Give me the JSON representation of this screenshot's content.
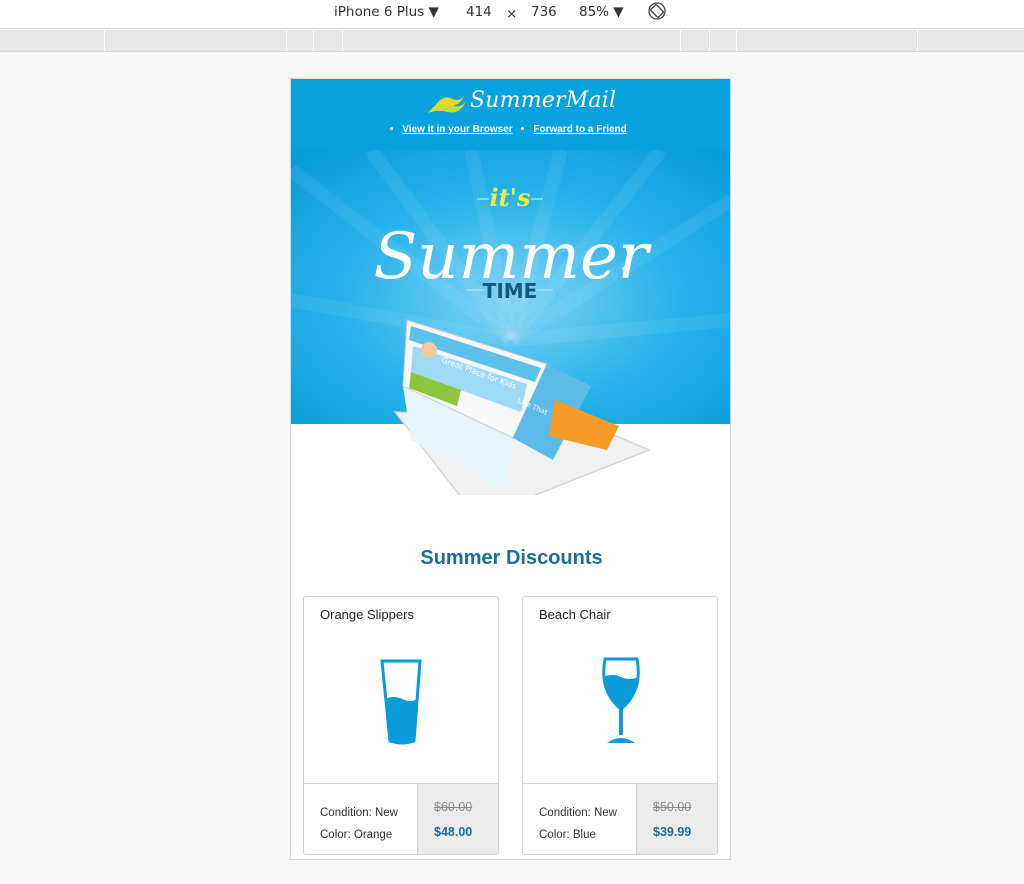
{
  "devtools": {
    "device": "iPhone 6 Plus ▼",
    "width": "414",
    "times": "×",
    "height": "736",
    "zoom": "85% ▼",
    "rotate_icon": "rotate-icon"
  },
  "email": {
    "brand": "SummerMail",
    "links": [
      "View it in your Browser",
      "Forward to a Friend"
    ],
    "hero": {
      "small": "it's",
      "big": "Summer",
      "sub": "TIME",
      "tablet_text": "Great Place for Kids",
      "tablet_side": "Like That"
    },
    "section_title": "Summer Discounts",
    "products": [
      {
        "name": "Orange Slippers",
        "condition": "Condition: New",
        "color": "Color: Orange",
        "old_price": "$60.00",
        "new_price": "$48.00",
        "icon": "tall-glass-icon"
      },
      {
        "name": "Beach Chair",
        "condition": "Condition: New",
        "color": "Color: Blue",
        "old_price": "$50.00",
        "new_price": "$39.99",
        "icon": "wine-glass-icon"
      }
    ]
  },
  "colors": {
    "header_blue": "#0aa2de",
    "title_blue": "#1a6f98",
    "icon_blue": "#0b9bd8"
  }
}
